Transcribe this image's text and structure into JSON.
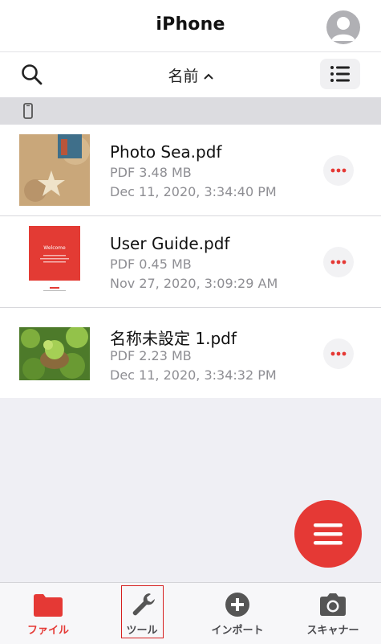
{
  "header": {
    "title": "iPhone"
  },
  "toolbar": {
    "sort_label": "名前"
  },
  "files": [
    {
      "name": "Photo Sea.pdf",
      "meta": "PDF  3.48 MB",
      "date": "Dec 11, 2020, 3:34:40 PM"
    },
    {
      "name": "User Guide.pdf",
      "meta": "PDF  0.45 MB",
      "date": "Nov 27, 2020, 3:09:29 AM"
    },
    {
      "name": "名称未設定 1.pdf",
      "meta": "PDF  2.23 MB",
      "date": "Dec 11, 2020, 3:34:32 PM"
    }
  ],
  "thumb_text": {
    "welcome": "Welcome"
  },
  "tabs": [
    {
      "label": "ファイル"
    },
    {
      "label": "ツール"
    },
    {
      "label": "インポート"
    },
    {
      "label": "スキャナー"
    }
  ],
  "colors": {
    "accent": "#e53935"
  }
}
